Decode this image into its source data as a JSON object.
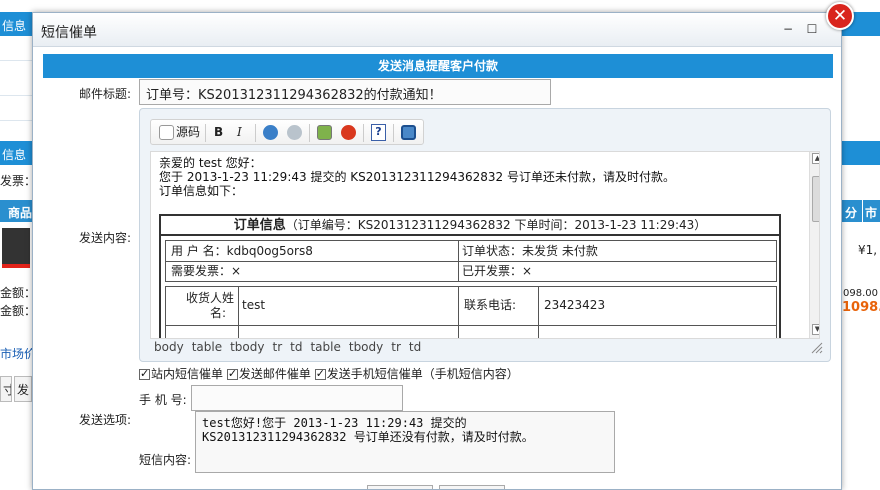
{
  "background": {
    "bar1_text": "信息（",
    "bar2_text": "信息",
    "invoice_label": "发票：",
    "product_col": "商品",
    "right_col_a": "分",
    "right_col_b": "市",
    "price": "¥1,",
    "amount_label1": "金额：",
    "amount_label2": "金额：",
    "amount_value1": "098.00 元",
    "amount_value2": "1098.0",
    "market_link": "市场价",
    "btn1": "寸",
    "btn2": "发"
  },
  "dialog": {
    "title": "短信催单",
    "minimize": "−",
    "maximize": "☐",
    "close": "✕",
    "banner": "发送消息提醒客户付款",
    "subject_label": "邮件标题:",
    "subject_value": "订单号：KS201312311294362832的付款通知！",
    "content_label": "发送内容:",
    "options_label": "发送选项:",
    "phone_label": "手 机 号:",
    "sms_label": "短信内容:",
    "phone_value": "",
    "sms_content": "test您好!您于 2013-1-23 11:29:43 提交的\nKS201312311294362832 号订单还没有付款，请及时付款。"
  },
  "toolbar": {
    "source_label": "源码",
    "bold": "B",
    "italic": "I",
    "help": "?"
  },
  "editor": {
    "greeting": "亲爱的 test 您好：",
    "line2": "您于 2013-1-23 11:29:43 提交的 KS201312311294362832 号订单还未付款，请及时付款。",
    "line3": "订单信息如下：",
    "order_title_bold": "订单信息",
    "order_title_rest": "（订单编号：KS201312311294362832 下单时间：2013-1-23 11:29:43）",
    "username_label": "用 户 名：",
    "username_value": "kdbq0og5ors8",
    "status_label": "订单状态：",
    "status_value": "未发货 未付款",
    "need_invoice_label": "需要发票：",
    "need_invoice_value": "×",
    "issued_invoice_label": "已开发票：",
    "issued_invoice_value": "×",
    "receiver_label_1": "收货人姓",
    "receiver_label_2": "名:",
    "receiver_value": "test",
    "phone_label": "联系电话:",
    "phone_value": "23423423",
    "path": [
      "body",
      "table",
      "tbody",
      "tr",
      "td",
      "table",
      "tbody",
      "tr",
      "td"
    ]
  },
  "checkboxes": [
    {
      "label": "站内短信催单",
      "checked": true
    },
    {
      "label": "发送邮件催单",
      "checked": true
    },
    {
      "label": "发送手机短信催单（手机短信内容）",
      "checked": true
    }
  ],
  "colors": {
    "accent": "#1e8fd6",
    "close": "#d9251d",
    "price_orange": "#e8630a"
  }
}
